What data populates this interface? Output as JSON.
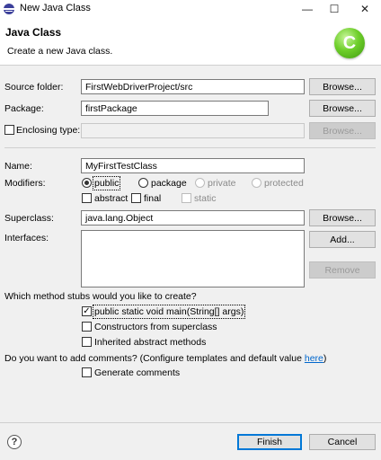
{
  "window": {
    "title": "New Java Class",
    "minimize": "—",
    "maximize": "☐",
    "close": "✕"
  },
  "banner": {
    "title": "Java Class",
    "description": "Create a new Java class.",
    "logo_letter": "C"
  },
  "source_folder": {
    "label": "Source folder:",
    "value": "FirstWebDriverProject/src",
    "browse": "Browse..."
  },
  "package": {
    "label": "Package:",
    "value": "firstPackage",
    "browse": "Browse..."
  },
  "enclosing_type": {
    "label": "Enclosing type:",
    "value": "",
    "browse": "Browse..."
  },
  "name": {
    "label": "Name:",
    "value": "MyFirstTestClass"
  },
  "modifiers": {
    "label": "Modifiers:",
    "public": "public",
    "package": "package",
    "private": "private",
    "protected": "protected",
    "abstract": "abstract",
    "final": "final",
    "static": "static",
    "selected": "public"
  },
  "superclass": {
    "label": "Superclass:",
    "value": "java.lang.Object",
    "browse": "Browse..."
  },
  "interfaces": {
    "label": "Interfaces:",
    "add": "Add...",
    "remove": "Remove"
  },
  "stubs": {
    "question": "Which method stubs would you like to create?",
    "main": "public static void main(String[] args)",
    "constructors": "Constructors from superclass",
    "inherited": "Inherited abstract methods",
    "main_checked": true
  },
  "comments": {
    "question": "Do you want to add comments? (Configure templates and default value ",
    "link": "here",
    "close": ")",
    "generate": "Generate comments"
  },
  "footer": {
    "help": "?",
    "finish": "Finish",
    "cancel": "Cancel"
  },
  "icons": {
    "app": "eclipse-app-icon",
    "logo": "new-class-wizard-icon",
    "help": "help-icon"
  }
}
